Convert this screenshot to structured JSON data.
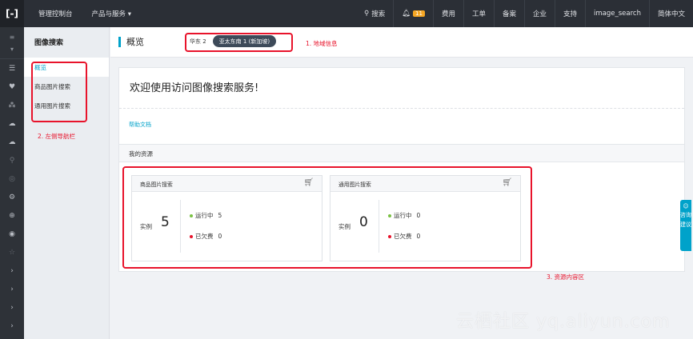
{
  "topbar": {
    "logo": "[-]",
    "console": "管理控制台",
    "products": "产品与服务 ▾",
    "search": "搜索",
    "notifications_count": "11",
    "links": [
      "费用",
      "工单",
      "备案",
      "企业",
      "支持",
      "image_search",
      "简体中文"
    ]
  },
  "rail": {
    "menu_glyph": "≡",
    "items": [
      "☰",
      "♥",
      "⁂",
      "☁",
      "☁",
      "⚲",
      "◎",
      "⚙",
      "⊕",
      "◉",
      "☆",
      "›",
      "›",
      "›",
      "›"
    ]
  },
  "sidenav": {
    "title": "图像搜索",
    "items": [
      "概览",
      "商品图片搜索",
      "通用图片搜索"
    ]
  },
  "main": {
    "title": "概览",
    "regions": [
      "华东 2",
      "亚太东南 1 (新加坡)"
    ],
    "welcome_title": "欢迎使用访问图像搜索服务!",
    "help_link": "帮助文档",
    "resources_title": "我的资源",
    "cards": [
      {
        "title": "商品图片搜索",
        "instance_label": "实例",
        "instance_count": "5",
        "running_label": "运行中",
        "running": "5",
        "overdue_label": "已欠费",
        "overdue": "0"
      },
      {
        "title": "通用图片搜索",
        "instance_label": "实例",
        "instance_count": "0",
        "running_label": "运行中",
        "running": "0",
        "overdue_label": "已欠费",
        "overdue": "0"
      }
    ]
  },
  "annotations": {
    "region": "1. 地域信息",
    "nav": "2. 左侧导航栏",
    "content": "3. 资源内容区"
  },
  "float_tab": {
    "line1": "咨询",
    "line2": "建议"
  },
  "watermark": "云栖社区 yq.aliyun.com",
  "colors": {
    "accent": "#00a2ca",
    "annotation": "#e8132b",
    "running": "#7ac143",
    "overdue": "#e8132b",
    "topbar": "#2b2f36"
  }
}
